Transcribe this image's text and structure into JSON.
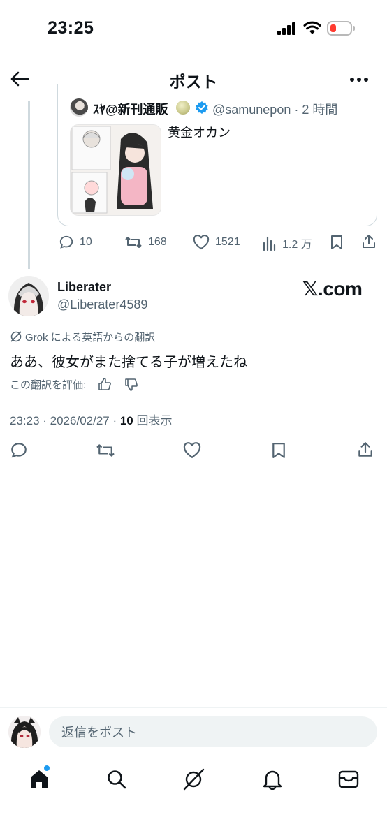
{
  "status_bar": {
    "time": "23:25"
  },
  "header": {
    "title": "ポスト"
  },
  "quoted_post": {
    "author_name": "ｽﾔ@新刊通販",
    "author_handle": "@samunepon",
    "time_ago": "2 時間",
    "text": "黄金オカン",
    "stats": {
      "replies": "10",
      "reposts": "168",
      "likes": "1521",
      "views": "1.2 万"
    }
  },
  "post": {
    "author_name": "Liberater",
    "author_handle": "@Liberater4589",
    "watermark": "𝕏.com",
    "translation_label": "Grok による英語からの翻訳",
    "text": "ああ、彼女がまた捨てる子が増えたね",
    "rate_translation_label": "この翻訳を評価:",
    "timestamp": "23:23 · 2026/02/27 · ",
    "views_count": "10",
    "views_label": " 回表示"
  },
  "reply": {
    "placeholder": "返信をポスト"
  },
  "colors": {
    "accent": "#1d9bf0",
    "muted": "#536471",
    "battery_low": "#ff3b30"
  },
  "icons": [
    "back-arrow-icon",
    "more-icon",
    "reply-icon",
    "repost-icon",
    "like-icon",
    "views-icon",
    "bookmark-icon",
    "share-icon",
    "home-icon",
    "search-icon",
    "grok-icon",
    "notifications-icon",
    "messages-icon"
  ]
}
